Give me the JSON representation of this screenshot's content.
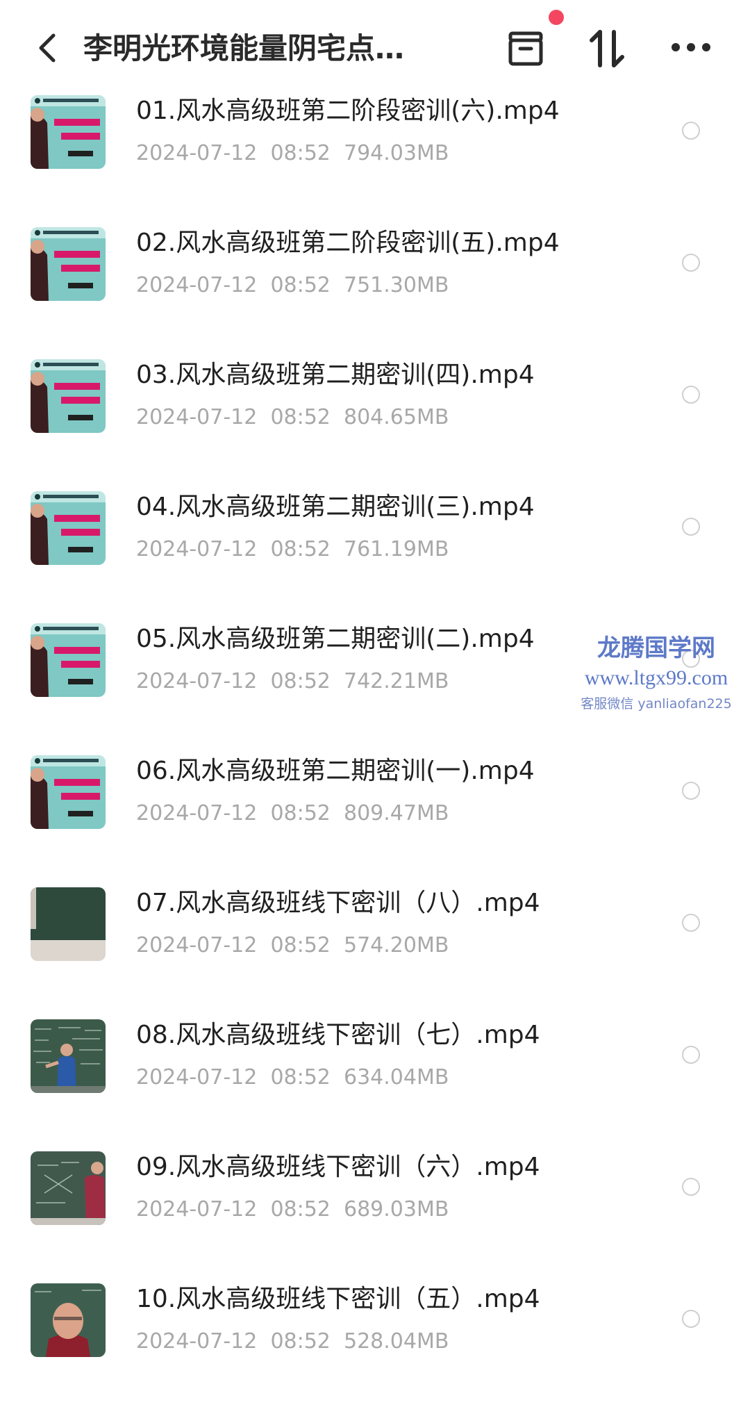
{
  "header": {
    "title": "李明光环境能量阴宅点…",
    "back_icon": "chevron-left-icon",
    "archive_icon": "archive-box-icon",
    "sort_icon": "sort-arrows-icon",
    "more_icon": "more-dots-icon",
    "notification_dot_color": "#f44660"
  },
  "files": [
    {
      "name": "01.风水高级班第二阶段密训(六).mp4",
      "date": "2024-07-12",
      "time": "08:52",
      "size": "794.03MB",
      "thumb": "poster"
    },
    {
      "name": "02.风水高级班第二阶段密训(五).mp4",
      "date": "2024-07-12",
      "time": "08:52",
      "size": "751.30MB",
      "thumb": "poster"
    },
    {
      "name": "03.风水高级班第二期密训(四).mp4",
      "date": "2024-07-12",
      "time": "08:52",
      "size": "804.65MB",
      "thumb": "poster"
    },
    {
      "name": "04.风水高级班第二期密训(三).mp4",
      "date": "2024-07-12",
      "time": "08:52",
      "size": "761.19MB",
      "thumb": "poster"
    },
    {
      "name": "05.风水高级班第二期密训(二).mp4",
      "date": "2024-07-12",
      "time": "08:52",
      "size": "742.21MB",
      "thumb": "poster"
    },
    {
      "name": "06.风水高级班第二期密训(一).mp4",
      "date": "2024-07-12",
      "time": "08:52",
      "size": "809.47MB",
      "thumb": "poster"
    },
    {
      "name": "07.风水高级班线下密训（八）.mp4",
      "date": "2024-07-12",
      "time": "08:52",
      "size": "574.20MB",
      "thumb": "blackboard"
    },
    {
      "name": "08.风水高级班线下密训（七）.mp4",
      "date": "2024-07-12",
      "time": "08:52",
      "size": "634.04MB",
      "thumb": "blackboard-teacher"
    },
    {
      "name": "09.风水高级班线下密训（六）.mp4",
      "date": "2024-07-12",
      "time": "08:52",
      "size": "689.03MB",
      "thumb": "blackboard-side"
    },
    {
      "name": "10.风水高级班线下密训（五）.mp4",
      "date": "2024-07-12",
      "time": "08:52",
      "size": "528.04MB",
      "thumb": "teacher-closeup"
    }
  ],
  "watermark": {
    "line1": "龙腾国学网",
    "line2": "www.ltgx99.com",
    "line3": "客服微信 yanliaofan225"
  }
}
